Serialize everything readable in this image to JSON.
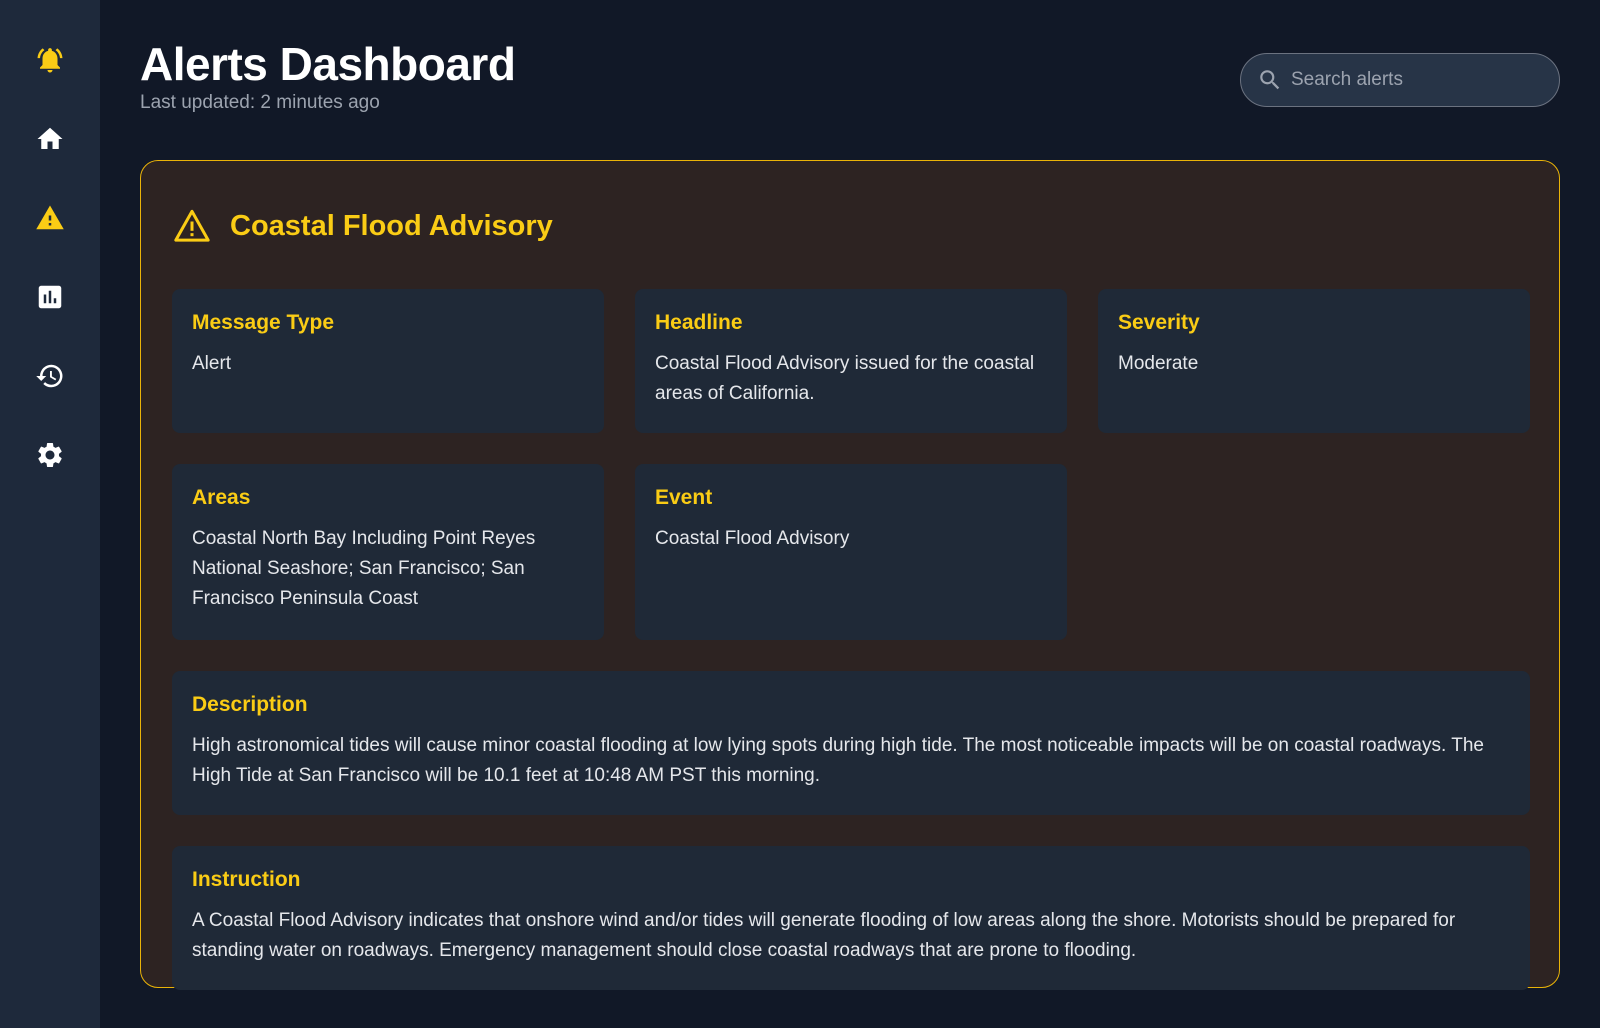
{
  "header": {
    "title": "Alerts Dashboard",
    "last_updated": "Last updated: 2 minutes ago"
  },
  "search": {
    "placeholder": "Search alerts",
    "value": ""
  },
  "sidebar": {
    "items": [
      {
        "name": "notifications",
        "icon": "bell-ring-icon",
        "active": true
      },
      {
        "name": "home",
        "icon": "home-icon"
      },
      {
        "name": "warnings",
        "icon": "warning-icon"
      },
      {
        "name": "analytics",
        "icon": "bar-chart-icon"
      },
      {
        "name": "history",
        "icon": "history-icon"
      },
      {
        "name": "settings",
        "icon": "gear-icon"
      }
    ]
  },
  "alert": {
    "title": "Coastal Flood Advisory",
    "fields": {
      "message_type": {
        "label": "Message Type",
        "value": "Alert"
      },
      "headline": {
        "label": "Headline",
        "value": "Coastal Flood Advisory issued for the coastal areas of California."
      },
      "severity": {
        "label": "Severity",
        "value": "Moderate"
      },
      "areas": {
        "label": "Areas",
        "value": "Coastal North Bay Including Point Reyes National Seashore; San Francisco; San Francisco Peninsula Coast"
      },
      "event": {
        "label": "Event",
        "value": "Coastal Flood Advisory"
      },
      "description": {
        "label": "Description",
        "value": "High astronomical tides will cause minor coastal flooding at low lying spots during high tide. The most noticeable impacts will be on coastal roadways. The High Tide at San Francisco will be 10.1 feet at 10:48 AM PST this morning."
      },
      "instruction": {
        "label": "Instruction",
        "value": "A Coastal Flood Advisory indicates that onshore wind and/or tides will generate flooding of low areas along the shore. Motorists should be prepared for standing water on roadways. Emergency management should close coastal roadways that are prone to flooding."
      }
    }
  },
  "colors": {
    "accent": "#facc15",
    "background": "#111827",
    "sidebar": "#1e293b",
    "card": "#2d2322",
    "field": "#1f2937"
  }
}
